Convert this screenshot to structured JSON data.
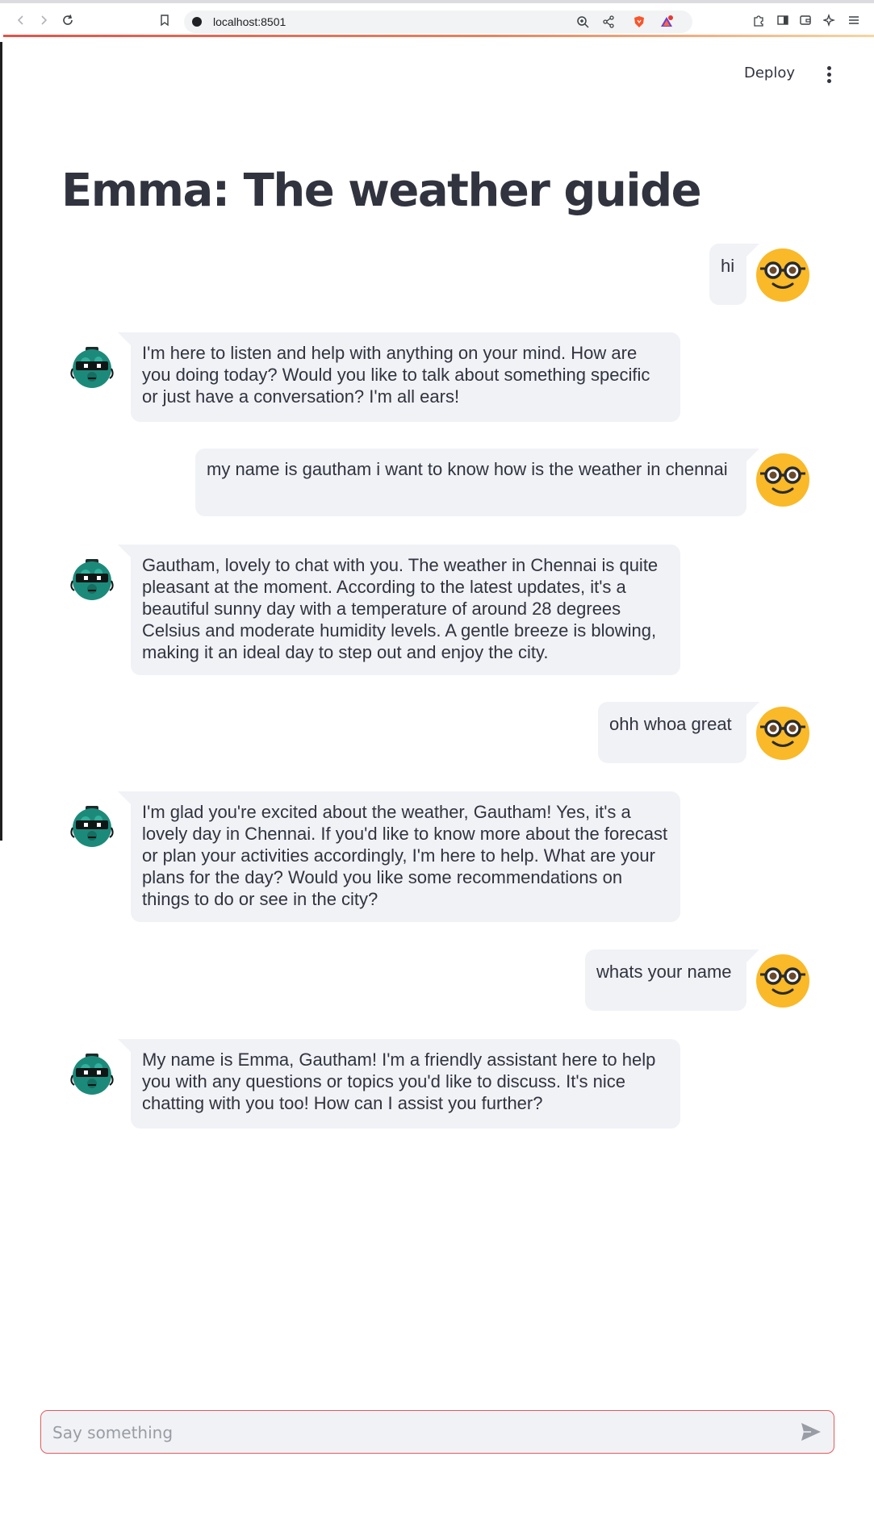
{
  "browser": {
    "url": "localhost:8501"
  },
  "header": {
    "deploy_label": "Deploy",
    "menu_icon": "kebab-menu-icon"
  },
  "title": "Emma: The weather guide",
  "messages": [
    {
      "role": "user",
      "text": "hi"
    },
    {
      "role": "assistant",
      "text": "I'm here to listen and help with anything on your mind. How are you doing today? Would you like to talk about something specific or just have a conversation? I'm all ears!"
    },
    {
      "role": "user",
      "text": "my name is gautham i want to know how is the weather in chennai"
    },
    {
      "role": "assistant",
      "text": "Gautham, lovely to chat with you. The weather in Chennai is quite pleasant at the moment. According to the latest updates, it's a beautiful sunny day with a temperature of around 28 degrees Celsius and moderate humidity levels. A gentle breeze is blowing, making it an ideal day to step out and enjoy the city."
    },
    {
      "role": "user",
      "text": "ohh whoa great"
    },
    {
      "role": "assistant",
      "text": "I'm glad you're excited about the weather, Gautham! Yes, it's a lovely day in Chennai. If you'd like to know more about the forecast or plan your activities accordingly, I'm here to help. What are your plans for the day? Would you like some recommendations on things to do or see in the city?"
    },
    {
      "role": "user",
      "text": "whats your name"
    },
    {
      "role": "assistant",
      "text": "My name is Emma, Gautham! I'm a friendly assistant here to help you with any questions or topics you'd like to discuss. It's nice chatting with you too! How can I assist you further?"
    }
  ],
  "chat_input": {
    "placeholder": "Say something",
    "value": ""
  },
  "colors": {
    "accent": "#e35b5b",
    "bubble": "#f0f2f6",
    "text": "#31333f",
    "user_avatar": "#f9b928",
    "bot_avatar": "#1c8a7a"
  }
}
